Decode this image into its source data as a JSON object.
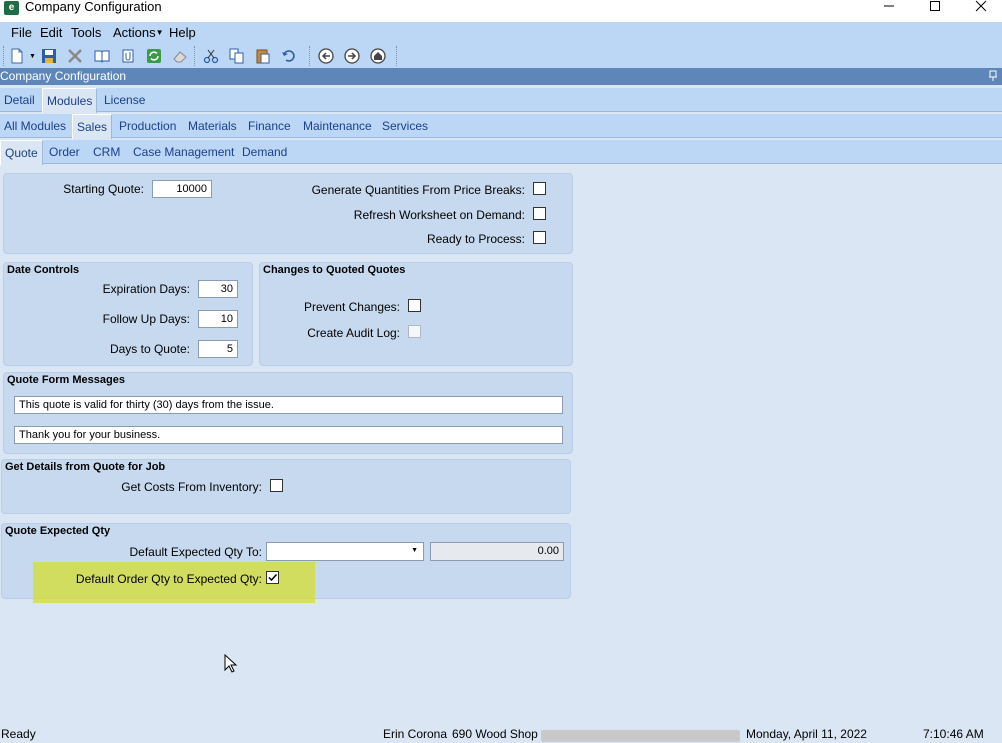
{
  "window": {
    "title": "Company Configuration",
    "icon_letter": "e",
    "controls": [
      "minimize-icon",
      "maximize-icon",
      "close-icon"
    ]
  },
  "menu": {
    "items": [
      "File",
      "Edit",
      "Tools",
      "Actions",
      "Help"
    ]
  },
  "toolbar": {
    "icons": [
      "new-icon",
      "save-icon",
      "delete-icon",
      "book-icon",
      "attach-icon",
      "refresh-icon",
      "eraser-icon",
      "cut-icon",
      "copy-icon",
      "paste-icon",
      "undo-icon",
      "back-icon",
      "forward-icon",
      "home-icon"
    ]
  },
  "panel": {
    "title": "Company Configuration"
  },
  "tabs1": [
    "Detail",
    "Modules",
    "License"
  ],
  "tabs2": [
    "All Modules",
    "Sales",
    "Production",
    "Materials",
    "Finance",
    "Maintenance",
    "Services"
  ],
  "tabs3": [
    "Quote",
    "Order",
    "CRM",
    "Case Management",
    "Demand"
  ],
  "general": {
    "starting_quote_label": "Starting Quote:",
    "starting_quote_value": "10000",
    "gen_qty_label": "Generate Quantities From Price Breaks:",
    "refresh_ws_label": "Refresh Worksheet on Demand:",
    "ready_label": "Ready to Process:"
  },
  "date_controls": {
    "title": "Date Controls",
    "expiration_label": "Expiration Days:",
    "expiration_value": "30",
    "followup_label": "Follow Up Days:",
    "followup_value": "10",
    "days_to_quote_label": "Days to Quote:",
    "days_to_quote_value": "5"
  },
  "changes": {
    "title": "Changes to Quoted Quotes",
    "prevent_label": "Prevent Changes:",
    "audit_label": "Create Audit Log:"
  },
  "messages": {
    "title": "Quote Form Messages",
    "msg1": "This quote is valid for thirty (30) days from the issue.",
    "msg2": "Thank you for your business."
  },
  "job_details": {
    "title": "Get Details from Quote for Job",
    "costs_label": "Get Costs From Inventory:"
  },
  "expected_qty": {
    "title": "Quote Expected Qty",
    "default_to_label": "Default Expected Qty To:",
    "default_to_value": "",
    "qty_value": "0.00",
    "order_qty_label": "Default Order Qty to Expected Qty:",
    "order_qty_checked": true
  },
  "highlight_color": "#d5de28",
  "status": {
    "ready": "Ready",
    "user": "Erin Corona",
    "site": "690 Wood Shop",
    "date": "Monday, April 11, 2022",
    "time": "7:10:46 AM"
  }
}
